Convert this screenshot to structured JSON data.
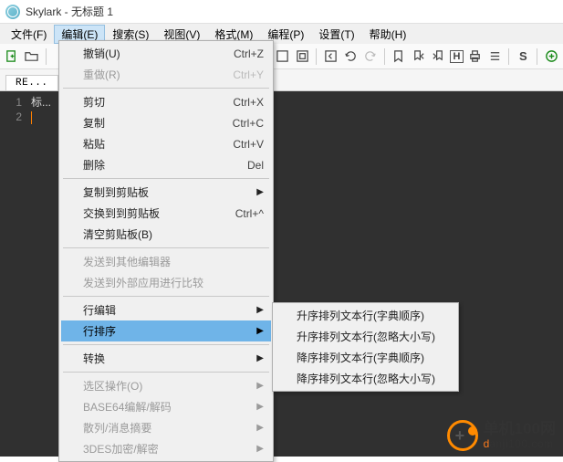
{
  "window": {
    "title": "Skylark - 无标题 1"
  },
  "menubar": {
    "items": [
      {
        "label": "文件(F)"
      },
      {
        "label": "编辑(E)"
      },
      {
        "label": "搜索(S)"
      },
      {
        "label": "视图(V)"
      },
      {
        "label": "格式(M)"
      },
      {
        "label": "编程(P)"
      },
      {
        "label": "设置(T)"
      },
      {
        "label": "帮助(H)"
      }
    ],
    "open_index": 1
  },
  "tabbar": {
    "active": "RE..."
  },
  "gutter": {
    "lines": [
      "1",
      "2"
    ]
  },
  "code": {
    "line1": "标..."
  },
  "edit_menu": {
    "items": [
      {
        "label": "撤销(U)",
        "shortcut": "Ctrl+Z",
        "type": "item"
      },
      {
        "label": "重做(R)",
        "shortcut": "Ctrl+Y",
        "type": "item",
        "disabled": true
      },
      {
        "type": "sep"
      },
      {
        "label": "剪切",
        "shortcut": "Ctrl+X",
        "type": "item"
      },
      {
        "label": "复制",
        "shortcut": "Ctrl+C",
        "type": "item"
      },
      {
        "label": "粘贴",
        "shortcut": "Ctrl+V",
        "type": "item"
      },
      {
        "label": "删除",
        "shortcut": "Del",
        "type": "item"
      },
      {
        "type": "sep"
      },
      {
        "label": "复制到剪贴板",
        "type": "submenu"
      },
      {
        "label": "交换到到剪贴板",
        "shortcut": "Ctrl+^",
        "type": "item"
      },
      {
        "label": "清空剪贴板(B)",
        "type": "item"
      },
      {
        "type": "sep"
      },
      {
        "label": "发送到其他编辑器",
        "type": "item",
        "disabled": true
      },
      {
        "label": "发送到外部应用进行比较",
        "type": "item",
        "disabled": true
      },
      {
        "type": "sep"
      },
      {
        "label": "行编辑",
        "type": "submenu"
      },
      {
        "label": "行排序",
        "type": "submenu",
        "highlight": true
      },
      {
        "type": "sep"
      },
      {
        "label": "转换",
        "type": "submenu"
      },
      {
        "type": "sep"
      },
      {
        "label": "选区操作(O)",
        "type": "submenu",
        "disabled": true
      },
      {
        "label": "BASE64编解/解码",
        "type": "submenu",
        "disabled": true
      },
      {
        "label": "散列/消息摘要",
        "type": "submenu",
        "disabled": true
      },
      {
        "label": "3DES加密/解密",
        "type": "submenu",
        "disabled": true
      }
    ]
  },
  "sort_submenu": {
    "items": [
      {
        "label": "升序排列文本行(字典顺序)"
      },
      {
        "label": "升序排列文本行(忽略大小写)"
      },
      {
        "label": "降序排列文本行(字典顺序)"
      },
      {
        "label": "降序排列文本行(忽略大小写)"
      }
    ]
  },
  "watermark": {
    "cn": "单机100网",
    "url_orange": "d",
    "url_rest": "anji100.com"
  },
  "toolbar_letters": {
    "h": "H",
    "s": "S"
  }
}
